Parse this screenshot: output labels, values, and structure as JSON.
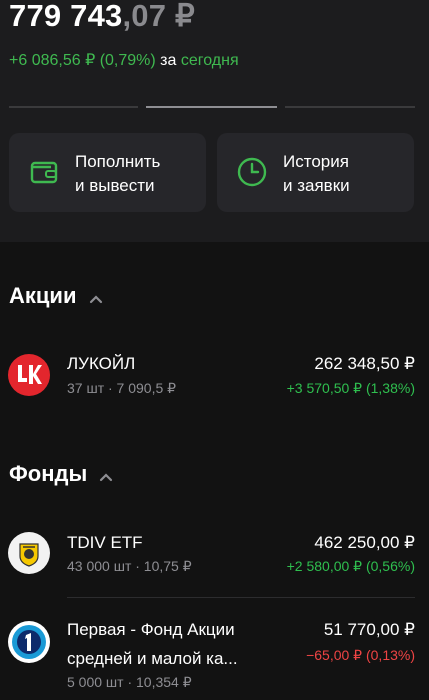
{
  "header": {
    "balance_main": "779 743",
    "balance_frac": ",07 ₽",
    "change_value": "+6 086,56 ₽ (0,79%)",
    "change_suffix_pre": "за",
    "change_suffix_link": "сегодня"
  },
  "actions": [
    {
      "label": "Пополнить\nи вывести",
      "icon": "wallet-icon"
    },
    {
      "label": "История\nи заявки",
      "icon": "clock-icon"
    }
  ],
  "sections": {
    "stocks": {
      "title": "Акции",
      "items": [
        {
          "name": "ЛУКОЙЛ",
          "sub": "37 шт · 7 090,5 ₽",
          "value": "262 348,50 ₽",
          "delta": "+3 570,50 ₽ (1,38%)",
          "trend": "up",
          "logo": "lukoil-logo"
        }
      ]
    },
    "funds": {
      "title": "Фонды",
      "items": [
        {
          "name": "TDIV ETF",
          "sub": "43 000 шт · 10,75 ₽",
          "value": "462 250,00 ₽",
          "delta": "+2 580,00 ₽ (0,56%)",
          "trend": "up",
          "logo": "tinkoff-logo"
        },
        {
          "name": "Первая - Фонд Акции",
          "name2": "средней и малой ка...",
          "sub": "5 000 шт · 10,354 ₽",
          "value": "51 770,00 ₽",
          "delta": "−65,00 ₽ (0,13%)",
          "trend": "down",
          "logo": "pervaya-logo"
        }
      ]
    }
  },
  "colors": {
    "background": "#121212",
    "header_bg": "#1c1c1e",
    "card_bg": "#26262a",
    "positive": "#3fb950",
    "negative": "#ef4444",
    "muted": "#8e8e93"
  }
}
